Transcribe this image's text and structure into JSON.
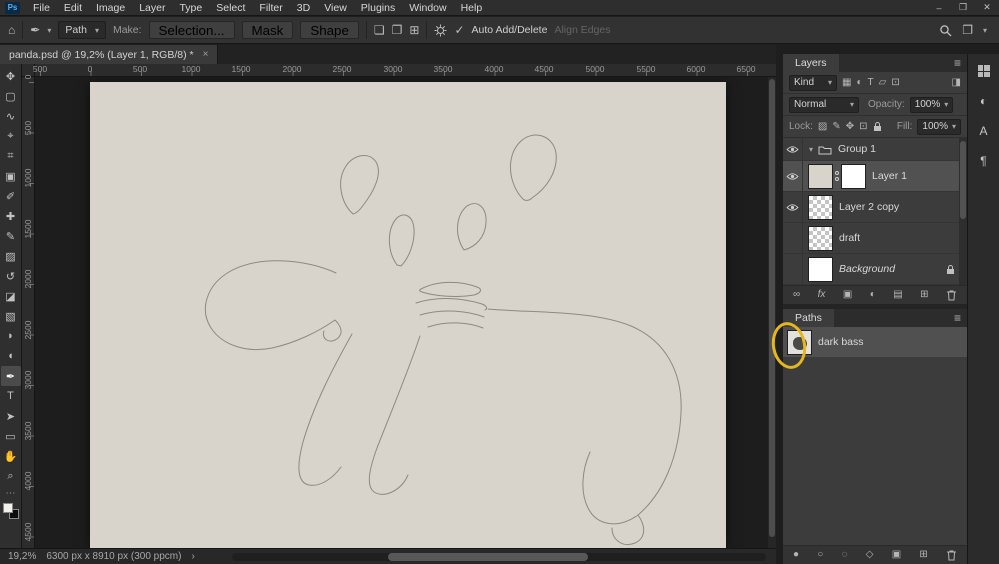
{
  "app": {
    "logo_text": "Ps",
    "menu_items": [
      "File",
      "Edit",
      "Image",
      "Layer",
      "Type",
      "Select",
      "Filter",
      "3D",
      "View",
      "Plugins",
      "Window",
      "Help"
    ],
    "window": {
      "minimize": "–",
      "restore": "❐",
      "close": "✕"
    }
  },
  "options_bar": {
    "tool_mode": "Path",
    "make_label": "Make:",
    "selection_button": "Selection...",
    "mask_button": "Mask",
    "shape_button": "Shape",
    "auto_add_delete": "Auto Add/Delete",
    "align_edges": "Align Edges"
  },
  "document_tab": {
    "title": "panda.psd @ 19,2% (Layer 1, RGB/8) *",
    "close_label": "×"
  },
  "toolbar": {
    "tools": [
      {
        "name": "move-tool",
        "glyph": "✥"
      },
      {
        "name": "marquee-tool",
        "glyph": "▢"
      },
      {
        "name": "lasso-tool",
        "glyph": "∿"
      },
      {
        "name": "object-selection-tool",
        "glyph": "⌖"
      },
      {
        "name": "crop-tool",
        "glyph": "⌗"
      },
      {
        "name": "frame-tool",
        "glyph": "▣"
      },
      {
        "name": "eyedropper-tool",
        "glyph": "✐"
      },
      {
        "name": "healing-tool",
        "glyph": "✚"
      },
      {
        "name": "brush-tool",
        "glyph": "✎"
      },
      {
        "name": "clone-stamp-tool",
        "glyph": "▨"
      },
      {
        "name": "history-brush-tool",
        "glyph": "↺"
      },
      {
        "name": "eraser-tool",
        "glyph": "◪"
      },
      {
        "name": "gradient-tool",
        "glyph": "▧"
      },
      {
        "name": "blur-tool",
        "glyph": "◗"
      },
      {
        "name": "dodge-tool",
        "glyph": "◖"
      },
      {
        "name": "pen-tool",
        "glyph": "✒"
      },
      {
        "name": "type-tool",
        "glyph": "T"
      },
      {
        "name": "path-selection-tool",
        "glyph": "➤"
      },
      {
        "name": "shape-tool",
        "glyph": "▭"
      },
      {
        "name": "hand-tool",
        "glyph": "✋"
      },
      {
        "name": "zoom-tool",
        "glyph": "⌕"
      }
    ],
    "more_glyph": "⋯"
  },
  "ruler": {
    "horizontal": [
      "500",
      "0",
      "500",
      "1000",
      "1500",
      "2000",
      "2500",
      "3000",
      "3500",
      "4000",
      "4500",
      "5000",
      "5500",
      "6000",
      "6500"
    ],
    "vertical": [
      "0",
      "500",
      "1000",
      "1500",
      "2000",
      "2500",
      "3000",
      "3500",
      "4000",
      "4500"
    ]
  },
  "canvas": {
    "background": "#d8d4cc",
    "stroke": "#8d8983",
    "paths": [
      "M263,132 C251,121 246,99 256,84 C263,73 279,69 286,80 C292,90 286,105 277,118 C272,125 268,131 263,132 Z",
      "M433,117 C419,103 415,75 430,60 C443,47 463,53 466,71 C468,89 457,106 442,116 C439,119 435,119 433,117 Z",
      "M307,183 C297,169 297,148 306,137 C313,129 323,133 324,147 C325,162 318,177 311,184 Z",
      "M374,168 C364,153 366,133 377,124 C388,117 397,126 396,141 C395,156 385,165 374,168 Z",
      "M331,207 C348,198 371,199 387,205 C393,207 391,211 384,213 C366,216 344,214 332,210 C329,209 329,208 331,207 Z",
      "M326,221 C348,214 373,216 392,222 C397,224 398,227 395,228",
      "M330,233 C353,226 378,229 394,235",
      "M338,245 C359,238 381,241 393,246",
      "M246,191 C216,177 168,173 139,190 C117,203 109,227 121,246 C133,264 158,271 182,266 C205,261 228,250 245,238 C250,243 254,250 248,256 C240,263 231,257 234,249",
      "M262,252 C244,284 224,322 213,360 C206,386 208,401 219,403 C231,405 243,396 251,385",
      "M398,227 C441,231 502,228 541,244 C576,259 593,291 591,331 C589,373 574,411 548,433 C529,447 507,444 498,426 C490,410 492,388 500,370",
      "M548,433 C556,444 556,456 545,461 C533,466 522,458 522,446",
      "M330,254 C318,290 301,330 287,366 C279,388 276,404 284,410 C296,417 312,407 318,393"
    ]
  },
  "layers_panel": {
    "title": "Layers",
    "filter_label": "Kind",
    "blend_mode": "Normal",
    "opacity_label": "Opacity:",
    "opacity_value": "100%",
    "lock_label": "Lock:",
    "fill_label": "Fill:",
    "fill_value": "100%",
    "fx_label": "fx",
    "layers": [
      {
        "name": "Group 1"
      },
      {
        "name": "Layer 1"
      },
      {
        "name": "Layer 2 copy"
      },
      {
        "name": "draft"
      },
      {
        "name": "Background"
      }
    ]
  },
  "paths_panel": {
    "title": "Paths",
    "items": [
      {
        "name": "dark bass"
      }
    ]
  },
  "status_bar": {
    "zoom": "19,2%",
    "doc_info": "6300 px x 8910 px (300 ppcm)",
    "chevron": "›"
  },
  "annotation": {
    "color": "#e6b71c"
  },
  "icons": {
    "home": "⌂",
    "pen": "✒",
    "chevron_down": "▾",
    "check": "✓",
    "panel_menu": "≡",
    "path_op_1": "❏",
    "path_op_2": "❐",
    "path_op_3": "⊞",
    "workspace": "❐",
    "collapse": "»",
    "filter_pixel": "▦",
    "filter_adjust": "◐",
    "filter_type": "T",
    "filter_shape": "▱",
    "filter_smart": "⊡",
    "filter_toggle": "◨",
    "lock_transparent": "▨",
    "lock_brush": "✎",
    "lock_move": "✥",
    "lock_artboard": "⊡",
    "link": "∞",
    "mask": "▣",
    "adjust": "◐",
    "group": "▤",
    "new": "⊞",
    "paths_fill": "●",
    "paths_stroke": "○",
    "paths_select": "◌",
    "paths_work": "◇",
    "paths_mask": "▣",
    "paths_new": "⊞",
    "adjustments_panel": "◐",
    "character_panel": "A",
    "paragraph_panel": "¶"
  }
}
